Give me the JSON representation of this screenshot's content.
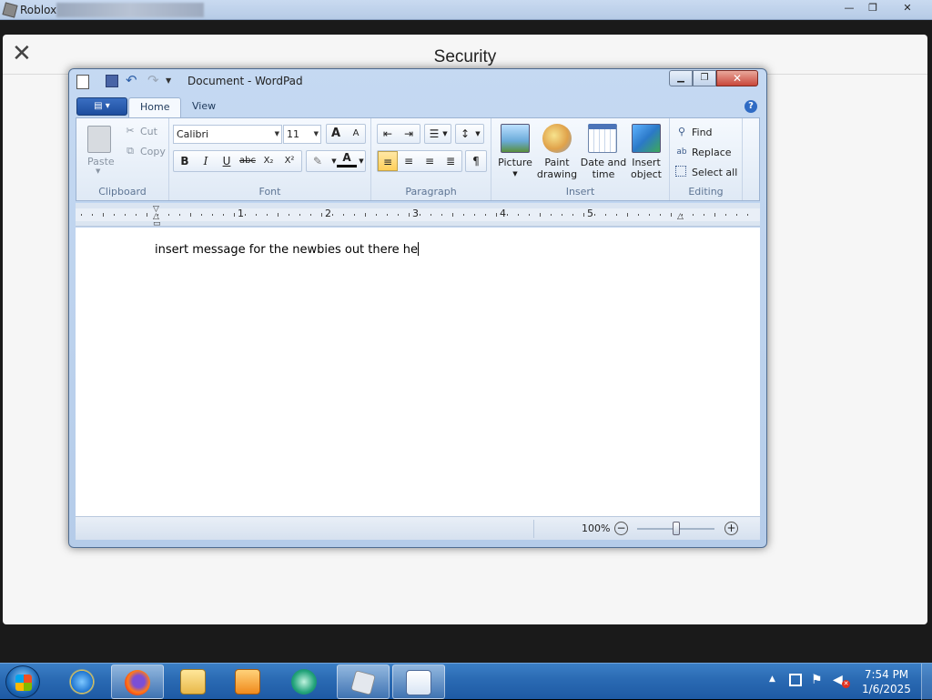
{
  "roblox": {
    "title": "Roblox",
    "minimize": "—",
    "restore": "❐",
    "close": "✕"
  },
  "security_panel": {
    "title": "Security",
    "close_glyph": "✕"
  },
  "wordpad": {
    "title": "Document - WordPad",
    "app_menu": "▤ ▾",
    "tabs": [
      "Home",
      "View"
    ],
    "help": "?",
    "clipboard": {
      "group_label": "Clipboard",
      "paste": "Paste",
      "cut": "Cut",
      "copy": "Copy"
    },
    "font": {
      "group_label": "Font",
      "family": "Calibri",
      "size": "11",
      "grow": "A",
      "shrink": "A",
      "bold": "B",
      "italic": "I",
      "underline": "U",
      "strike": "abc",
      "subscript": "X₂",
      "superscript": "X²",
      "highlight": "✎",
      "color": "A"
    },
    "paragraph": {
      "group_label": "Paragraph",
      "selected_alignment": "left"
    },
    "insert": {
      "group_label": "Insert",
      "picture": "Picture",
      "paint_line1": "Paint",
      "paint_line2": "drawing",
      "datetime_line1": "Date and",
      "datetime_line2": "time",
      "object_line1": "Insert",
      "object_line2": "object"
    },
    "editing": {
      "group_label": "Editing",
      "find": "Find",
      "replace": "Replace",
      "select_all": "Select all"
    },
    "ruler": {
      "numbers": [
        "1",
        "2",
        "3",
        "4",
        "5"
      ]
    },
    "document_text": "insert message for the newbies out there he",
    "statusbar": {
      "zoom": "100%",
      "zoom_fraction": 0.5,
      "zoom_out": "−",
      "zoom_in": "+"
    }
  },
  "taskbar": {
    "apps": [
      "internet-explorer",
      "firefox",
      "file-explorer",
      "media-player",
      "photos",
      "roblox",
      "wordpad"
    ],
    "active_apps": [
      "firefox",
      "roblox",
      "wordpad"
    ],
    "time": "7:54 PM",
    "date": "1/6/2025",
    "tray_arrow": "▲"
  },
  "colors": {
    "accent": "#2a6ab3",
    "ribbon_selected": "#ffcf5a",
    "close_red": "#c8473a"
  }
}
